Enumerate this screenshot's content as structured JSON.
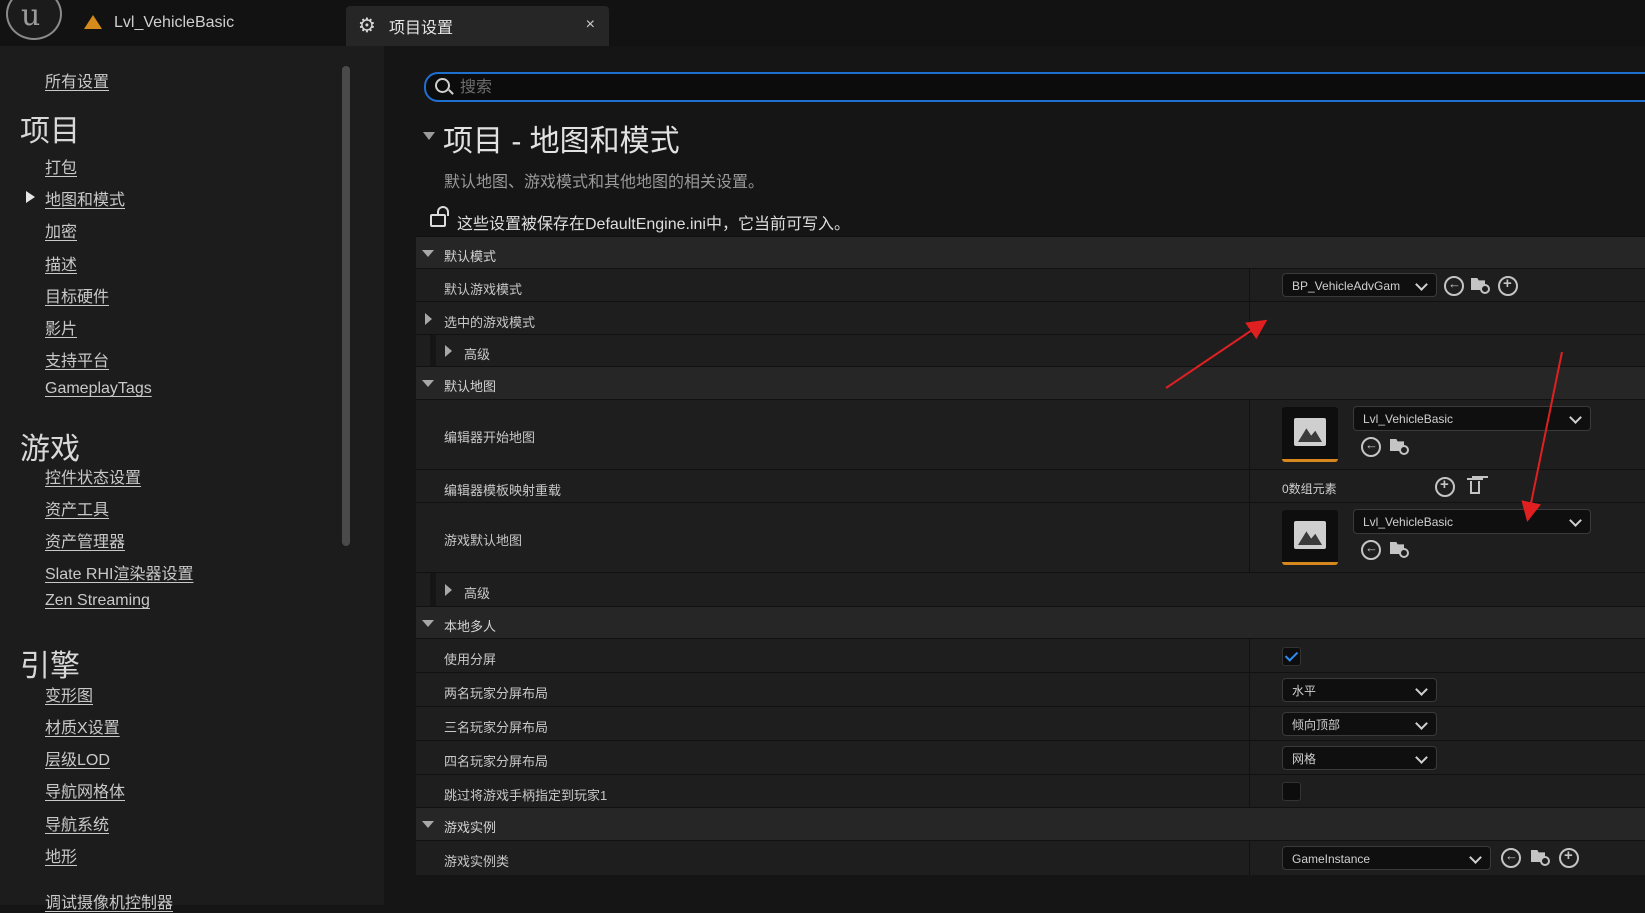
{
  "tabs": {
    "level_tab": "Lvl_VehicleBasic",
    "settings_tab": "项目设置",
    "close_glyph": "×"
  },
  "sidebar": {
    "all_settings": "所有设置",
    "categories": [
      {
        "title": "项目",
        "items": [
          "打包",
          "地图和模式",
          "加密",
          "描述",
          "目标硬件",
          "影片",
          "支持平台",
          "GameplayTags"
        ],
        "selected": "地图和模式"
      },
      {
        "title": "游戏",
        "items": [
          "控件状态设置",
          "资产工具",
          "资产管理器",
          "Slate RHI渲染器设置",
          "Zen Streaming"
        ]
      },
      {
        "title": "引擎",
        "items": [
          "变形图",
          "材质X设置",
          "层级LOD",
          "导航网格体",
          "导航系统",
          "地形",
          "调试摄像机控制器"
        ]
      }
    ]
  },
  "search": {
    "placeholder": "搜索"
  },
  "section": {
    "title": "项目 - 地图和模式",
    "description": "默认地图、游戏模式和其他地图的相关设置。",
    "config_note": "这些设置被保存在DefaultEngine.ini中，它当前可写入。"
  },
  "properties": {
    "default_modes": {
      "category": "默认模式",
      "default_game_mode_label": "默认游戏模式",
      "default_game_mode_value": "BP_VehicleAdvGam",
      "selected_game_mode_label": "选中的游戏模式",
      "advanced_label": "高级"
    },
    "default_maps": {
      "category": "默认地图",
      "editor_startup_map_label": "编辑器开始地图",
      "editor_startup_map_value": "Lvl_VehicleBasic",
      "editor_template_override_label": "编辑器模板映射重载",
      "editor_template_override_value": "0数组元素",
      "game_default_map_label": "游戏默认地图",
      "game_default_map_value": "Lvl_VehicleBasic",
      "advanced_label": "高级"
    },
    "local_multiplayer": {
      "category": "本地多人",
      "use_splitscreen_label": "使用分屏",
      "use_splitscreen_checked": true,
      "two_player_label": "两名玩家分屏布局",
      "two_player_value": "水平",
      "three_player_label": "三名玩家分屏布局",
      "three_player_value": "倾向顶部",
      "four_player_label": "四名玩家分屏布局",
      "four_player_value": "网格",
      "skip_gamepad_label": "跳过将游戏手柄指定到玩家1",
      "skip_gamepad_checked": false
    },
    "game_instance": {
      "category": "游戏实例",
      "game_instance_class_label": "游戏实例类",
      "game_instance_class_value": "GameInstance"
    }
  },
  "colors": {
    "accent_blue": "#1f6fd1",
    "check_blue": "#2e8bef",
    "map_thumb_orange": "#d7881c",
    "annotation_red": "#e02020"
  }
}
